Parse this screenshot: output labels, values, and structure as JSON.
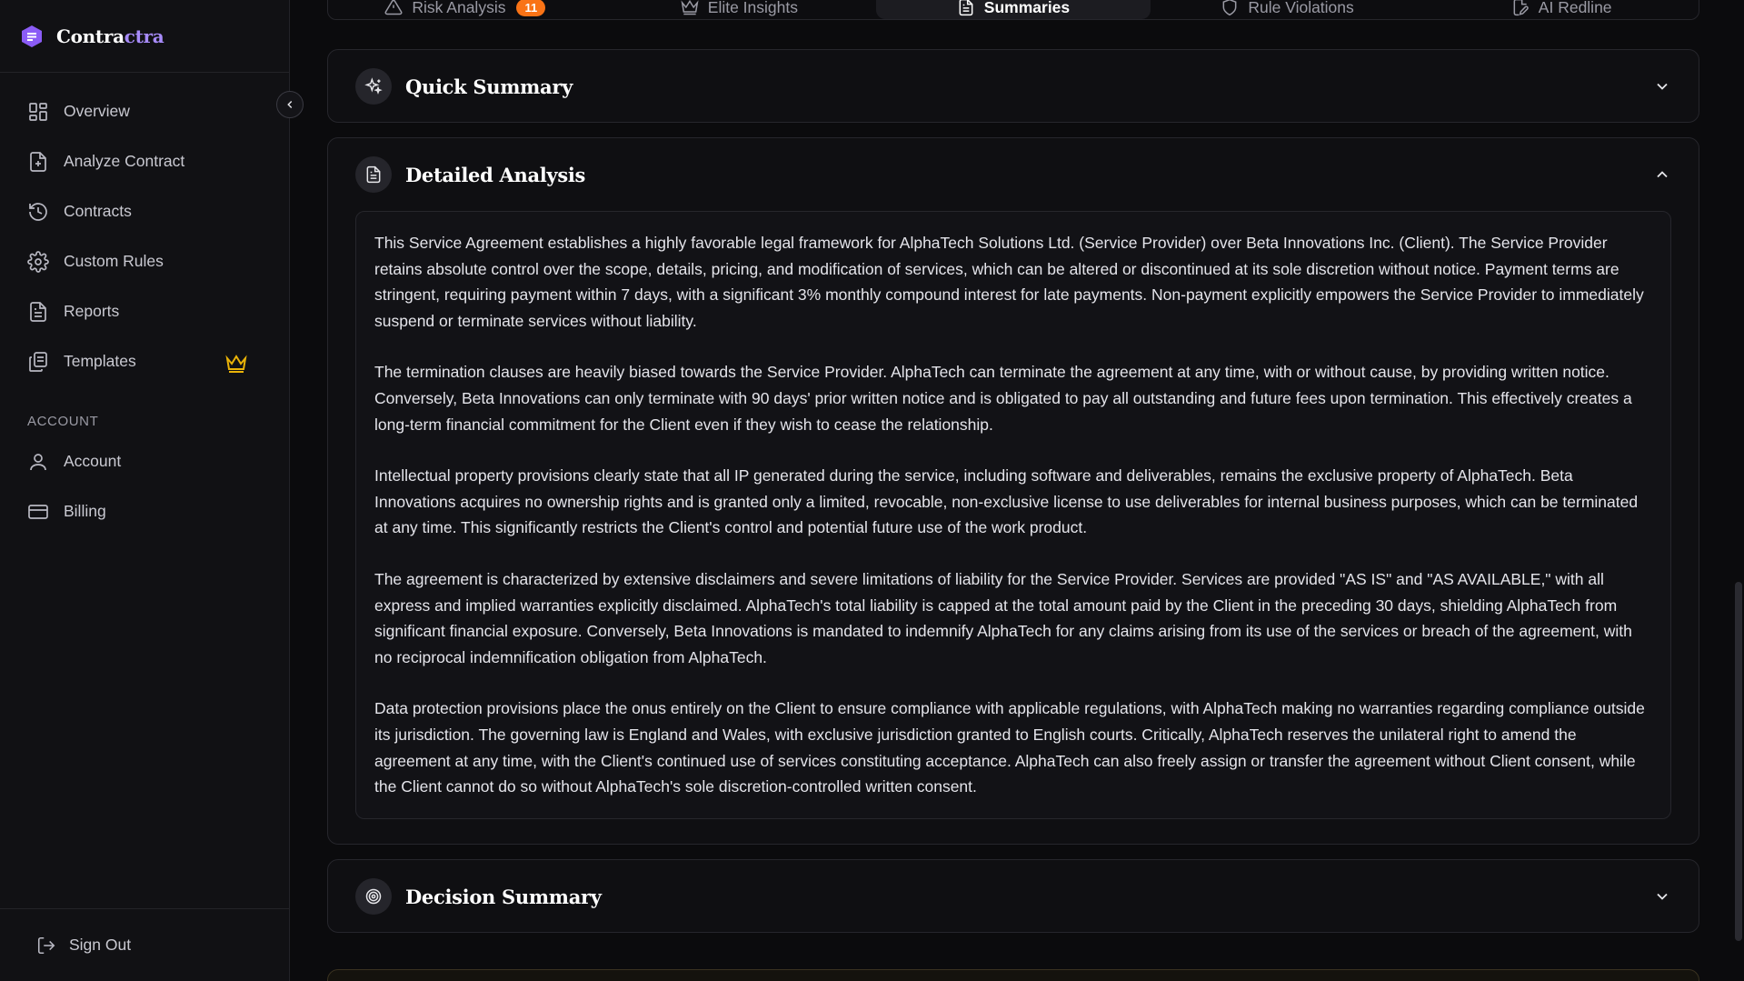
{
  "brand": {
    "name_main": "Contra",
    "name_accent": "ctra",
    "accent_color": "#a78bfa"
  },
  "sidebar": {
    "items": [
      {
        "label": "Overview",
        "icon": "grid-icon"
      },
      {
        "label": "Analyze Contract",
        "icon": "file-plus-icon"
      },
      {
        "label": "Contracts",
        "icon": "history-icon"
      },
      {
        "label": "Custom Rules",
        "icon": "gear-icon"
      },
      {
        "label": "Reports",
        "icon": "file-text-icon"
      },
      {
        "label": "Templates",
        "icon": "copy-icon",
        "badge_icon": "crown-icon"
      }
    ],
    "account_section_label": "ACCOUNT",
    "account_items": [
      {
        "label": "Account",
        "icon": "user-icon"
      },
      {
        "label": "Billing",
        "icon": "credit-card-icon"
      }
    ],
    "sign_out_label": "Sign Out"
  },
  "tabs": [
    {
      "label": "Risk Analysis",
      "icon": "warning-icon",
      "badge": "11"
    },
    {
      "label": "Elite Insights",
      "icon": "crown-icon"
    },
    {
      "label": "Summaries",
      "icon": "file-text-icon",
      "active": true
    },
    {
      "label": "Rule Violations",
      "icon": "shield-icon"
    },
    {
      "label": "AI Redline",
      "icon": "file-edit-icon"
    }
  ],
  "cards": {
    "quick_summary": {
      "title": "Quick Summary",
      "icon": "sparkle-icon",
      "expanded": false
    },
    "detailed_analysis": {
      "title": "Detailed Analysis",
      "icon": "file-text-icon",
      "expanded": true,
      "paragraphs": [
        "This Service Agreement establishes a highly favorable legal framework for AlphaTech Solutions Ltd. (Service Provider) over Beta Innovations Inc. (Client). The Service Provider retains absolute control over the scope, details, pricing, and modification of services, which can be altered or discontinued at its sole discretion without notice. Payment terms are stringent, requiring payment within 7 days, with a significant 3% monthly compound interest for late payments. Non-payment explicitly empowers the Service Provider to immediately suspend or terminate services without liability.",
        "The termination clauses are heavily biased towards the Service Provider. AlphaTech can terminate the agreement at any time, with or without cause, by providing written notice. Conversely, Beta Innovations can only terminate with 90 days' prior written notice and is obligated to pay all outstanding and future fees upon termination. This effectively creates a long-term financial commitment for the Client even if they wish to cease the relationship.",
        "Intellectual property provisions clearly state that all IP generated during the service, including software and deliverables, remains the exclusive property of AlphaTech. Beta Innovations acquires no ownership rights and is granted only a limited, revocable, non-exclusive license to use deliverables for internal business purposes, which can be terminated at any time. This significantly restricts the Client's control and potential future use of the work product.",
        "The agreement is characterized by extensive disclaimers and severe limitations of liability for the Service Provider. Services are provided \"AS IS\" and \"AS AVAILABLE,\" with all express and implied warranties explicitly disclaimed. AlphaTech's total liability is capped at the total amount paid by the Client in the preceding 30 days, shielding AlphaTech from significant financial exposure. Conversely, Beta Innovations is mandated to indemnify AlphaTech for any claims arising from its use of the services or breach of the agreement, with no reciprocal indemnification obligation from AlphaTech.",
        "Data protection provisions place the onus entirely on the Client to ensure compliance with applicable regulations, with AlphaTech making no warranties regarding compliance outside its jurisdiction. The governing law is England and Wales, with exclusive jurisdiction granted to English courts. Critically, AlphaTech reserves the unilateral right to amend the agreement at any time, with the Client's continued use of services constituting acceptance. AlphaTech can also freely assign or transfer the agreement without Client consent, while the Client cannot do so without AlphaTech's sole discretion-controlled written consent."
      ]
    },
    "decision_summary": {
      "title": "Decision Summary",
      "icon": "target-icon",
      "expanded": false
    }
  },
  "colors": {
    "badge_orange": "#f97316",
    "crown_gold": "#eab308"
  }
}
